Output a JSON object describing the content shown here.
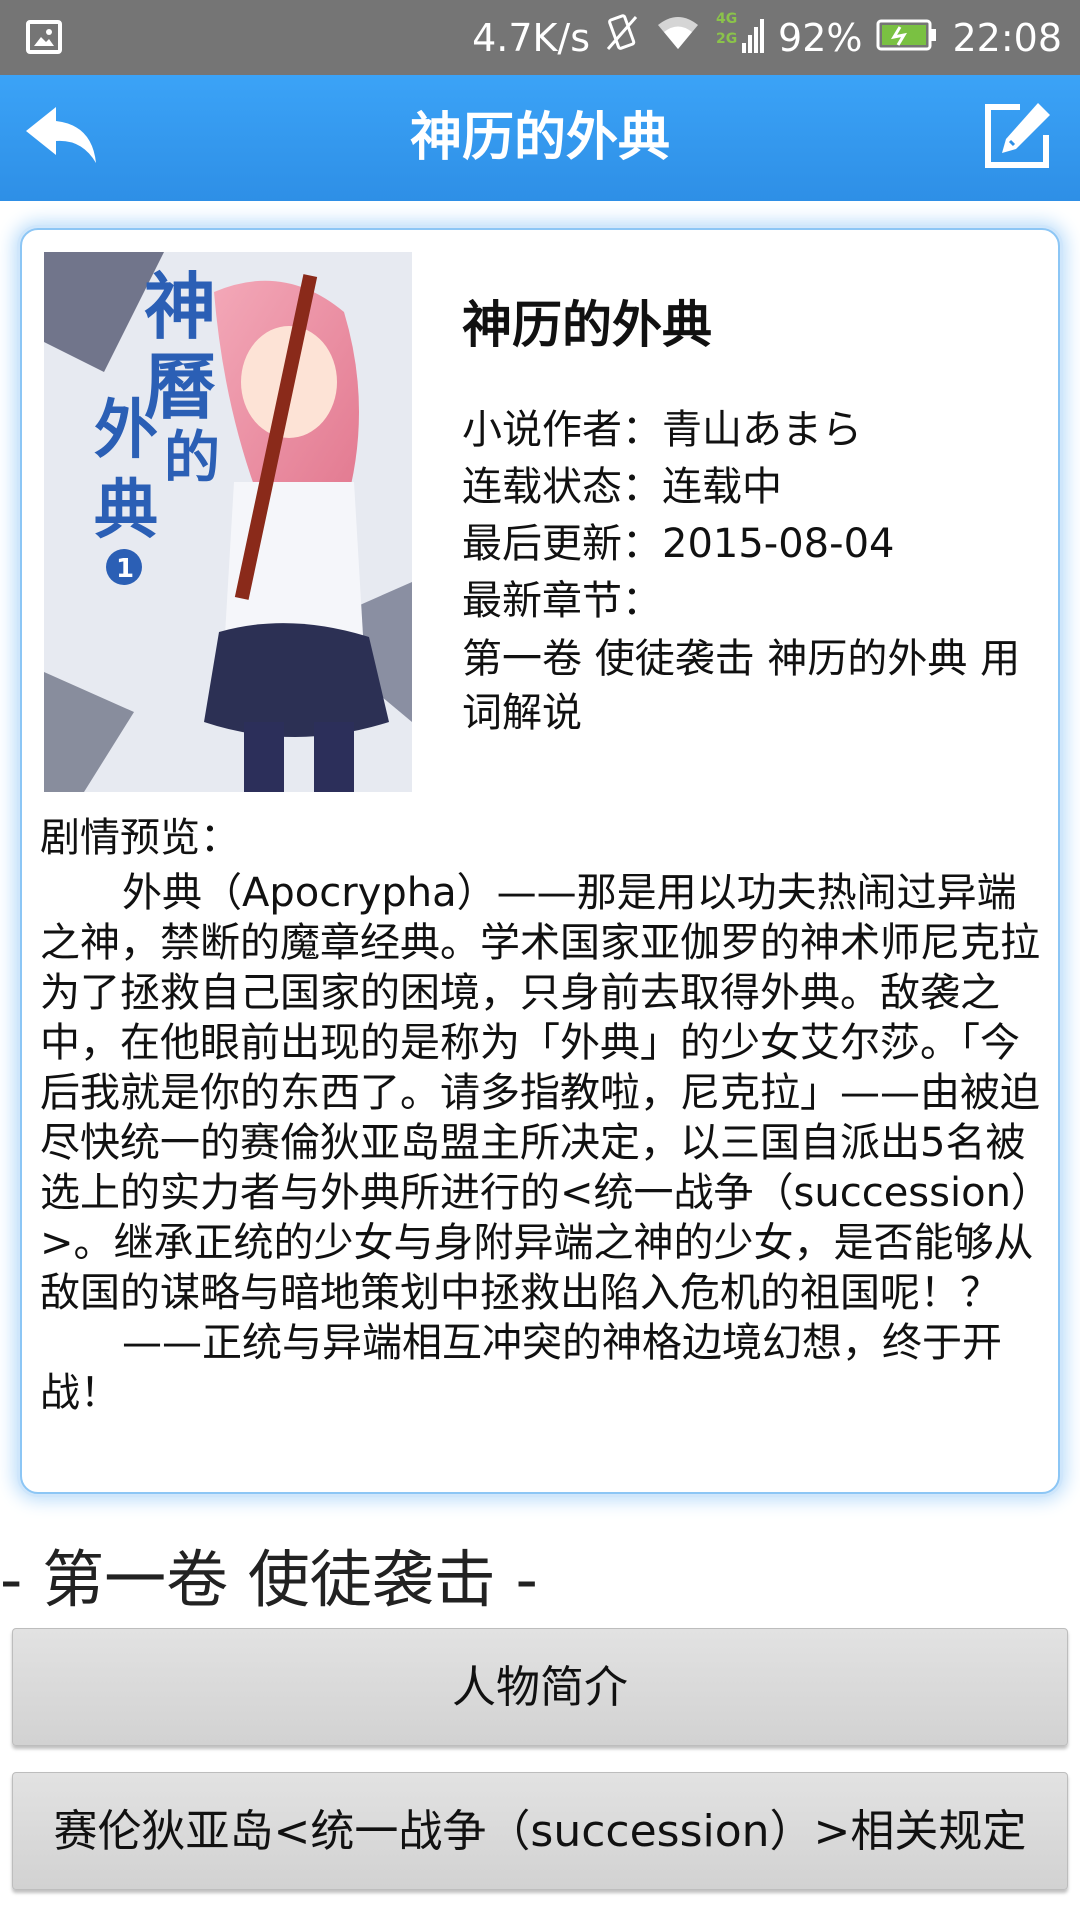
{
  "status_bar": {
    "speed": "4.7K/s",
    "network": "4G 2G",
    "battery": "92%",
    "time": "22:08"
  },
  "toolbar": {
    "title": "神历的外典",
    "back_icon": "back-arrow-icon",
    "edit_icon": "edit-icon"
  },
  "book": {
    "name": "神历的外典",
    "author_label": "小说作者：",
    "author": "青山あまら",
    "status_label": "连载状态：",
    "status": "连载中",
    "updated_label": "最后更新：",
    "updated": "2015-08-04",
    "latest_label": "最新章节：",
    "latest": "第一卷 使徒袭击 神历的外典 用词解说",
    "summary_label": "剧情预览：",
    "summary_p1": "外典（Apocrypha）——那是用以功夫热闹过异端之神，禁断的魔章经典。学术国家亚伽罗的神术师尼克拉为了拯救自己国家的困境，只身前去取得外典。敌袭之中，在他眼前出现的是称为「外典」的少女艾尔莎。「今后我就是你的东西了。请多指教啦，尼克拉」——由被迫尽快统一的赛倫狄亚岛盟主所决定，以三国自派出5名被选上的实力者与外典所进行的<统一战争（succession）>。继承正统的少女与身附异端之神的少女，是否能够从敌国的谋略与暗地策划中拯救出陷入危机的祖国呢！？",
    "summary_p2": "——正统与异端相互冲突的神格边境幻想，终于开战！"
  },
  "volume": {
    "title": "- 第一卷 使徒袭击 -",
    "chapters": [
      "人物简介",
      "赛伦狄亚岛<统一战争（succession）>相关规定"
    ]
  },
  "colors": {
    "toolbar": "#3ba3f7",
    "status_bar": "#757575",
    "card_border": "#8cc6f5"
  }
}
